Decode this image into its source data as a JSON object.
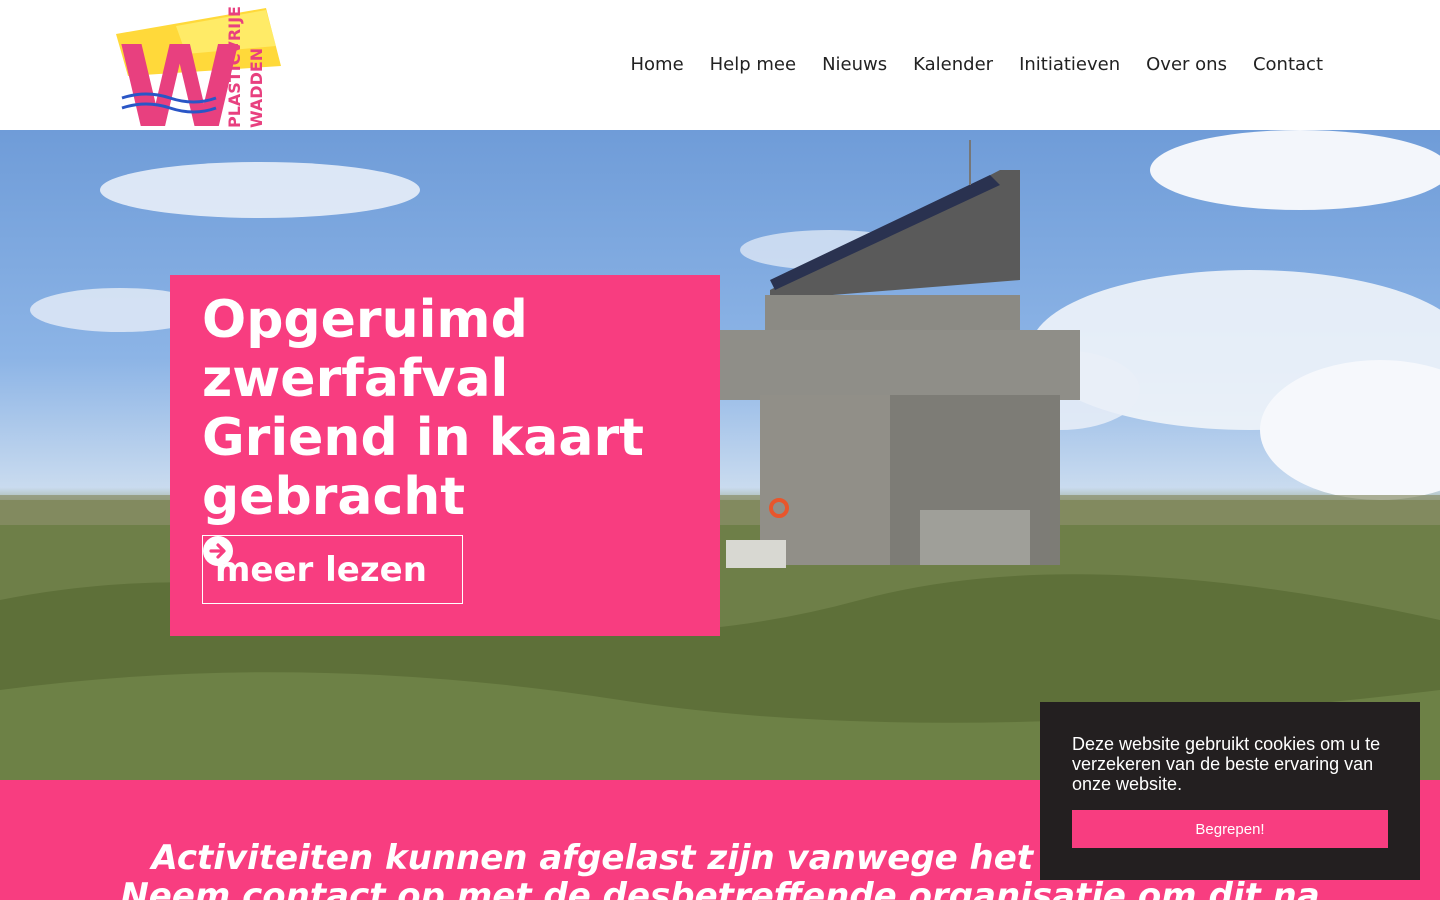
{
  "brand": {
    "logo_letter": "W",
    "logo_line1": "PLASTICVRIJE",
    "logo_line2": "WADDEN",
    "colors": {
      "pink": "#f83d80",
      "yellow": "#ffd93a",
      "blue": "#2a56c6",
      "dark": "#231f20"
    }
  },
  "nav": {
    "items": [
      "Home",
      "Help mee",
      "Nieuws",
      "Kalender",
      "Initiatieven",
      "Over ons",
      "Contact"
    ]
  },
  "hero": {
    "title": "Opgeruimd zwerfafval Griend in kaart gebracht",
    "button_label": "meer lezen",
    "button_icon": "arrow-circle-right-icon",
    "image": "wooden-observation-tower-on-grassy-island"
  },
  "notice": {
    "line1": "Activiteiten kunnen afgelast zijn vanwege het Coronavirus.",
    "line2": "Neem contact op met de desbetreffende organisatie om dit na"
  },
  "cookie": {
    "text": "Deze website gebruikt cookies om u te verzekeren van de beste ervaring van onze website.",
    "button_label": "Begrepen!"
  }
}
